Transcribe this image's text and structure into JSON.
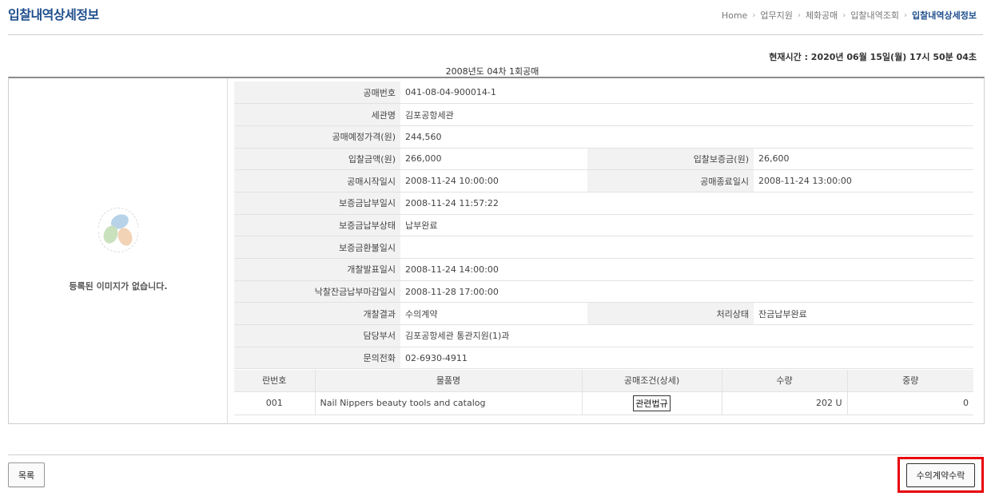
{
  "header": {
    "title": "입찰내역상세정보",
    "breadcrumb": [
      "Home",
      "업무지원",
      "체화공매",
      "입찰내역조회",
      "입찰내역상세정보"
    ]
  },
  "current_time": "현재시간 : 2020년 06월 15일(월) 17시 50분 04초",
  "sale_title": "2008년도 04차 1회공매",
  "image_panel": {
    "no_image_text": "등록된 이미지가 없습니다.",
    "logo_icon": "korea-customs-service-logo"
  },
  "details": {
    "sale_no": {
      "label": "공매번호",
      "value": "041-08-04-900014-1"
    },
    "customs_office": {
      "label": "세관명",
      "value": "김포공항세관"
    },
    "planned_price": {
      "label": "공매예정가격(원)",
      "value": "244,560"
    },
    "bid_amount": {
      "label": "입찰금액(원)",
      "value": "266,000"
    },
    "bid_deposit": {
      "label": "입찰보증금(원)",
      "value": "26,600"
    },
    "sale_start": {
      "label": "공매시작일시",
      "value": "2008-11-24 10:00:00"
    },
    "sale_end": {
      "label": "공매종료일시",
      "value": "2008-11-24 13:00:00"
    },
    "deposit_paid_at": {
      "label": "보증금납부일시",
      "value": "2008-11-24 11:57:22"
    },
    "deposit_status": {
      "label": "보증금납부상태",
      "value": "납부완료"
    },
    "deposit_refund_at": {
      "label": "보증금환불일시",
      "value": ""
    },
    "opening_at": {
      "label": "개찰발표일시",
      "value": "2008-11-24 14:00:00"
    },
    "balance_due_at": {
      "label": "낙찰잔금납부마감일시",
      "value": "2008-11-28 17:00:00"
    },
    "opening_result": {
      "label": "개찰결과",
      "value": "수의계약"
    },
    "process_status": {
      "label": "처리상태",
      "value": "잔금납부완료"
    },
    "department": {
      "label": "담당부서",
      "value": "김포공항세관  통관지원(1)과"
    },
    "contact_phone": {
      "label": "문의전화",
      "value": "02-6930-4911"
    }
  },
  "items": {
    "headers": [
      "란번호",
      "물품명",
      "공매조건(상세)",
      "수량",
      "중량"
    ],
    "rows": [
      {
        "no": "001",
        "name": "Nail Nippers beauty tools and catalog",
        "condition_button": "관련법규",
        "quantity": "202 U",
        "weight": "0"
      }
    ]
  },
  "buttons": {
    "list": "목록",
    "accept_private_contract": "수의계약수락"
  },
  "colors": {
    "title": "#1f4e8c",
    "highlight": "#e8000b",
    "label_bg": "#f2f2f2"
  }
}
